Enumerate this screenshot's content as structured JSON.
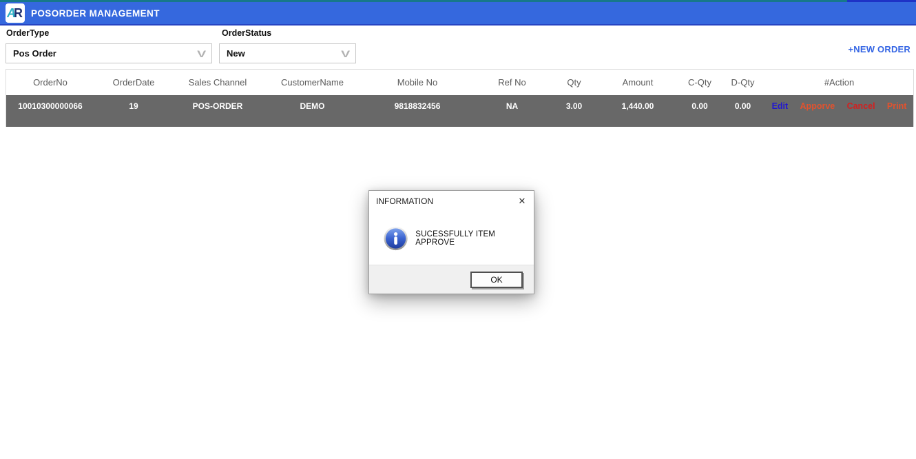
{
  "header": {
    "app_title": "POSORDER MANAGEMENT"
  },
  "filters": {
    "order_type_label": "OrderType",
    "order_type_value": "Pos Order",
    "order_status_label": "OrderStatus",
    "order_status_value": "New",
    "chevron_glyph": "V",
    "new_order_label": "+NEW ORDER"
  },
  "table": {
    "columns": [
      "OrderNo",
      "OrderDate",
      "Sales Channel",
      "CustomerName",
      "Mobile No",
      "Ref No",
      "Qty",
      "Amount",
      "C-Qty",
      "D-Qty",
      "#Action"
    ],
    "rows": [
      {
        "order_no": "10010300000066",
        "order_date": "19",
        "sales_channel": "POS-ORDER",
        "customer_name": "DEMO",
        "mobile_no": "9818832456",
        "ref_no": "NA",
        "qty": "3.00",
        "amount": "1,440.00",
        "c_qty": "0.00",
        "d_qty": "0.00",
        "actions": [
          "Edit",
          "Apporve",
          "Cancel",
          "Print"
        ]
      }
    ]
  },
  "dialog": {
    "title": "INFORMATION",
    "close_glyph": "✕",
    "message": "SUCESSFULLY ITEM APPROVE",
    "ok_label": "OK"
  },
  "colors": {
    "header_bar": "#3568de",
    "top_strip_teal": "#17788a",
    "top_strip_blue": "#1e32c6",
    "accent_blue": "#3465e4",
    "row_background": "#686868",
    "action_edit": "#2218cf",
    "action_apporve": "#e2522e",
    "action_cancel": "#d32020",
    "action_print": "#e2522e",
    "info_icon_blue": "#2b50c0"
  }
}
